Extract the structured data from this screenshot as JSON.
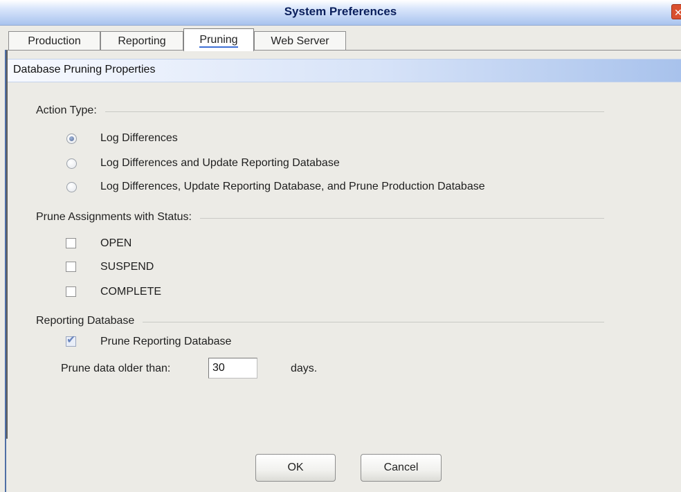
{
  "window": {
    "title": "System Preferences",
    "close_glyph": "✕"
  },
  "tabs": [
    {
      "label": "Production",
      "active": false
    },
    {
      "label": "Reporting",
      "active": false
    },
    {
      "label": "Pruning",
      "active": true
    },
    {
      "label": "Web Server",
      "active": false
    }
  ],
  "panel": {
    "header": "Database Pruning Properties",
    "action_type": {
      "label": "Action Type:",
      "options": [
        {
          "label": "Log Differences",
          "selected": true
        },
        {
          "label": "Log Differences and Update Reporting Database",
          "selected": false
        },
        {
          "label": "Log Differences, Update Reporting Database, and Prune Production Database",
          "selected": false
        }
      ]
    },
    "prune_status": {
      "label": "Prune Assignments with Status:",
      "options": [
        {
          "label": "OPEN",
          "checked": false
        },
        {
          "label": "SUSPEND",
          "checked": false
        },
        {
          "label": "COMPLETE",
          "checked": false
        }
      ]
    },
    "reporting_db": {
      "label": "Reporting Database",
      "prune_checkbox": {
        "label": "Prune Reporting Database",
        "checked": true
      },
      "older_than_label": "Prune data older than:",
      "days_value": "30",
      "days_unit": "days."
    }
  },
  "buttons": {
    "ok": "OK",
    "cancel": "Cancel"
  },
  "colors": {
    "title_text": "#0a1f5c",
    "close_button": "#d9502f",
    "header_gradient_end": "#a8c2ec"
  }
}
